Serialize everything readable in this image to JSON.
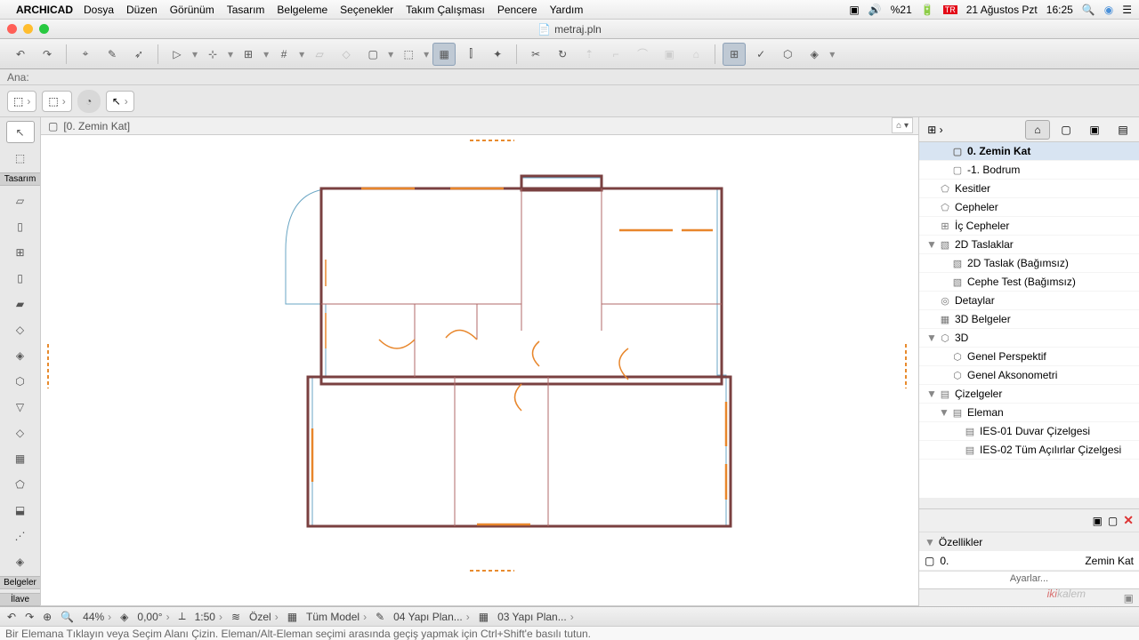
{
  "menubar": {
    "app": "ARCHICAD",
    "items": [
      "Dosya",
      "Düzen",
      "Görünüm",
      "Tasarım",
      "Belgeleme",
      "Seçenekler",
      "Takım Çalışması",
      "Pencere",
      "Yardım"
    ],
    "battery": "%21",
    "date": "21 Ağustos Pzt",
    "time": "16:25"
  },
  "window": {
    "filename": "metraj.pln"
  },
  "infobar": {
    "label": "Ana:"
  },
  "tab": {
    "title": "[0. Zemin Kat]"
  },
  "lefttools": {
    "design_label": "Tasarım",
    "docs_label": "Belgeler",
    "more_label": "İlave"
  },
  "navigator": {
    "items": [
      {
        "label": "0. Zemin Kat",
        "pad": 1,
        "icon": "story",
        "sel": true
      },
      {
        "label": "-1. Bodrum",
        "pad": 1,
        "icon": "story"
      },
      {
        "label": "Kesitler",
        "pad": 0,
        "icon": "section"
      },
      {
        "label": "Cepheler",
        "pad": 0,
        "icon": "elev"
      },
      {
        "label": "İç Cepheler",
        "pad": 0,
        "icon": "intelev"
      },
      {
        "label": "2D Taslaklar",
        "pad": 0,
        "icon": "worksheet",
        "tw": "▼"
      },
      {
        "label": "2D Taslak (Bağımsız)",
        "pad": 1,
        "icon": "worksheet"
      },
      {
        "label": "Cephe Test (Bağımsız)",
        "pad": 1,
        "icon": "worksheet"
      },
      {
        "label": "Detaylar",
        "pad": 0,
        "icon": "detail"
      },
      {
        "label": "3D Belgeler",
        "pad": 0,
        "icon": "3ddoc"
      },
      {
        "label": "3D",
        "pad": 0,
        "icon": "3d",
        "tw": "▼"
      },
      {
        "label": "Genel Perspektif",
        "pad": 1,
        "icon": "3d"
      },
      {
        "label": "Genel Aksonometri",
        "pad": 1,
        "icon": "3d"
      },
      {
        "label": "Çizelgeler",
        "pad": 0,
        "icon": "sched",
        "tw": "▼"
      },
      {
        "label": "Eleman",
        "pad": 1,
        "icon": "sched",
        "tw": "▼"
      },
      {
        "label": "IES-01 Duvar Çizelgesi",
        "pad": 2,
        "icon": "sched"
      },
      {
        "label": "IES-02 Tüm Açılırlar Çizelgesi",
        "pad": 2,
        "icon": "sched"
      }
    ]
  },
  "properties": {
    "header": "Özellikler",
    "story_num": "0.",
    "story_name": "Zemin Kat",
    "settings": "Ayarlar..."
  },
  "bottombar": {
    "zoom": "44%",
    "angle": "0,00°",
    "scale": "1:50",
    "special": "Özel",
    "model": "Tüm Model",
    "layer_combo": "04 Yapı Plan...",
    "view": "03 Yapı Plan..."
  },
  "status": {
    "text": "Bir Elemana Tıklayın veya Seçim Alanı Çizin.  Eleman/Alt-Eleman seçimi arasında geçiş yapmak için Ctrl+Shift'e basılı tutun."
  },
  "watermark": {
    "pre": "iki",
    "post": "kalem"
  }
}
